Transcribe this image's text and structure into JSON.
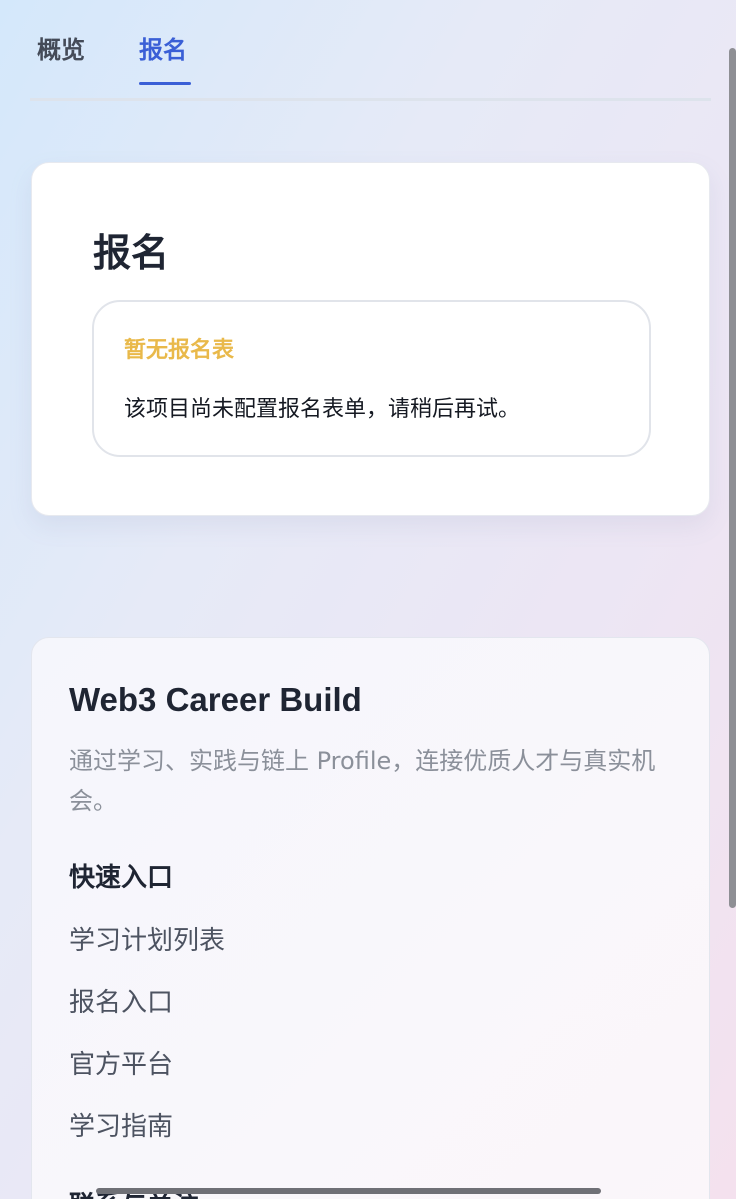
{
  "tabs": {
    "overview_label": "概览",
    "signup_label": "报名",
    "active": "signup"
  },
  "signup_card": {
    "title": "报名",
    "notice_title": "暂无报名表",
    "notice_body": "该项目尚未配置报名表单，请稍后再试。"
  },
  "footer_card": {
    "brand_title": "Web3 Career Build",
    "brand_desc": "通过学习、实践与链上 Profile，连接优质人才与真实机会。",
    "quick_entry_title": "快速入口",
    "quick_links": [
      "学习计划列表",
      "报名入口",
      "官方平台",
      "学习指南"
    ],
    "section2_title": "联系与关注"
  },
  "colors": {
    "accent": "#3a5fd6",
    "notice_title": "#e9b94a",
    "text_primary": "#1f2533",
    "text_muted": "#8b909a"
  }
}
